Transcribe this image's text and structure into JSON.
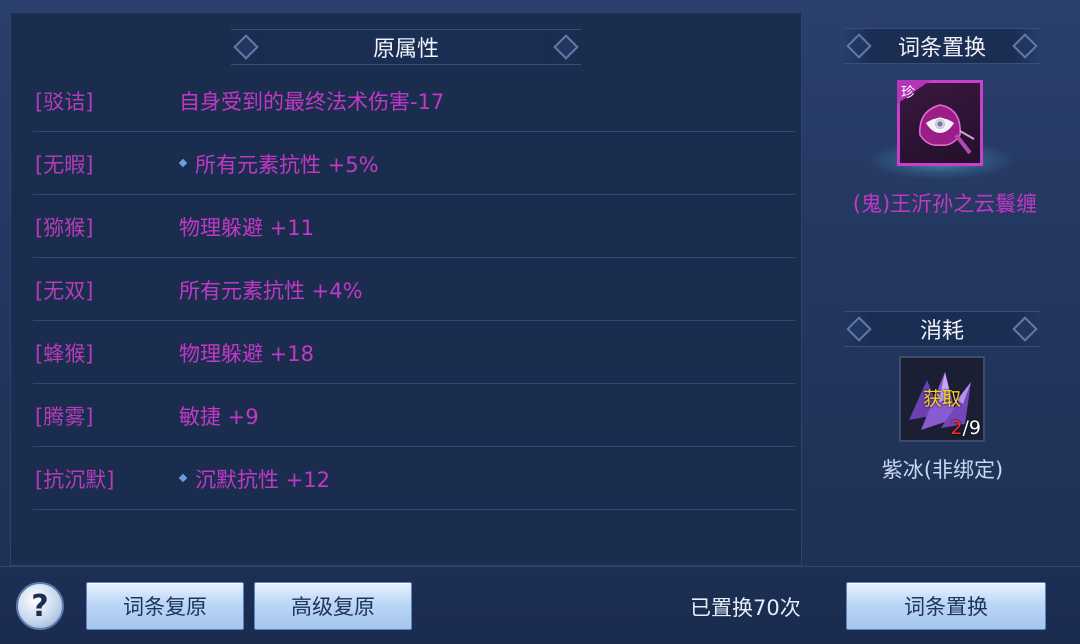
{
  "original_attributes": {
    "header": "原属性",
    "rows": [
      {
        "name": "[驳诘]",
        "value": "自身受到的最终法术伤害-17",
        "marked": false
      },
      {
        "name": "[无暇]",
        "value": "所有元素抗性 +5%",
        "marked": true
      },
      {
        "name": "[猕猴]",
        "value": "物理躲避 +11",
        "marked": false
      },
      {
        "name": "[无双]",
        "value": "所有元素抗性 +4%",
        "marked": false
      },
      {
        "name": "[蜂猴]",
        "value": "物理躲避 +18",
        "marked": false
      },
      {
        "name": "[腾雾]",
        "value": "敏捷 +9",
        "marked": false
      },
      {
        "name": "[抗沉默]",
        "value": "沉默抗性 +12",
        "marked": true
      }
    ]
  },
  "replace_target": {
    "header": "词条置换",
    "item_badge": "珍",
    "item_name": "(鬼)王沂孙之云鬟缠"
  },
  "consume": {
    "header": "消耗",
    "item_overlay": "获取",
    "owned": "2",
    "required": "/9",
    "item_name": "紫冰(非绑定)"
  },
  "bottom": {
    "help_label": "?",
    "restore_button": "词条复原",
    "advanced_restore_button": "高级复原",
    "replace_count": "已置换70次",
    "replace_button": "词条置换"
  },
  "colors": {
    "attribute_text": "#c238c6",
    "panel_bg": "#1b2d4f",
    "button_bg": "#bcd6f6",
    "item_name": "#c238c6",
    "consume_name": "#c8d8f2"
  }
}
